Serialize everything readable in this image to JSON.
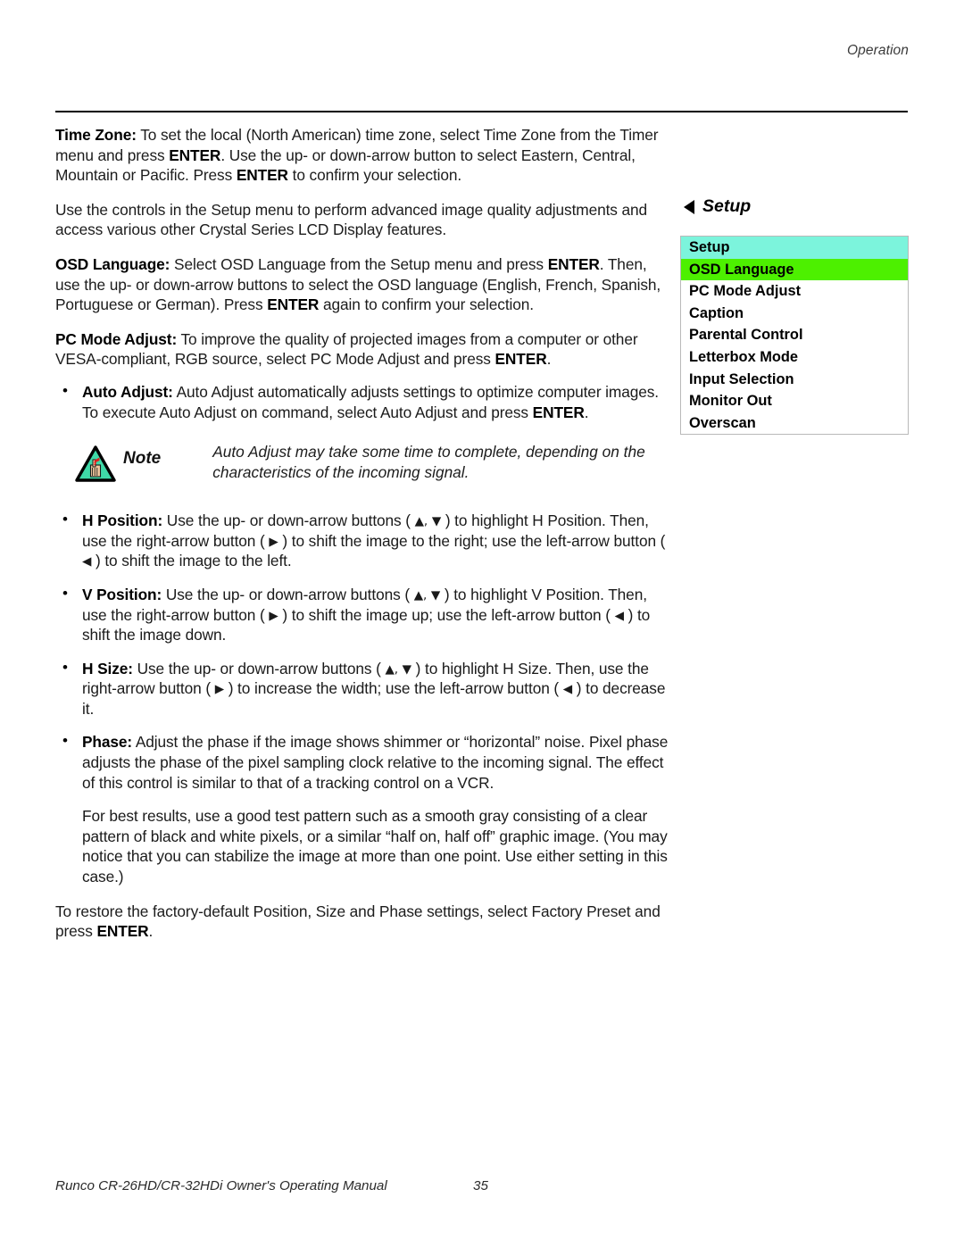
{
  "header": {
    "running_head": "Operation"
  },
  "footer": {
    "manual_title": "Runco CR-26HD/CR-32HDi Owner's Operating Manual",
    "page_number": "35"
  },
  "colors": {
    "osd_header_bg": "#7CF4DC",
    "osd_selected_bg": "#4DF000",
    "osd_border": "#b9b9b9",
    "note_triangle_fill": "#3FD9A8",
    "note_string_red": "#E01E1E"
  },
  "content": {
    "time_zone": {
      "term": "Time Zone:",
      "t1": " To set the local (North American) time zone, select Time Zone from the Timer menu and press ",
      "b1": "ENTER",
      "t2": ". Use the up- or down-arrow button to select Eastern, Central, Mountain or Pacific. Press ",
      "b2": "ENTER",
      "t3": " to confirm your selection."
    },
    "setup_intro": "Use the controls in the Setup menu to perform advanced image quality adjustments and access various other Crystal Series LCD Display features.",
    "osd_language": {
      "term": "OSD Language:",
      "t1": " Select OSD Language from the Setup menu and press ",
      "b1": "ENTER",
      "t2": ". Then, use the up- or down-arrow buttons to select the OSD language (English, French, Spanish, Portuguese or German). Press ",
      "b2": "ENTER",
      "t3": " again to confirm your selection."
    },
    "pc_mode_adjust": {
      "term": "PC Mode Adjust:",
      "t1": " To improve the quality of projected images from a computer or other VESA-compliant, RGB source, select PC Mode Adjust and press ",
      "b1": "ENTER",
      "t2": "."
    },
    "auto_adjust": {
      "term": "Auto Adjust:",
      "t1": " Auto Adjust automatically adjusts settings to optimize computer images. To execute Auto Adjust on command, select Auto Adjust and press ",
      "b1": "ENTER",
      "t2": "."
    },
    "note": {
      "label": "Note",
      "text": "Auto Adjust may take some time to complete, depending on the characteristics of the incoming signal."
    },
    "h_position": {
      "term": "H Position:",
      "t1": " Use the up- or down-arrow buttons ( ",
      "g1": "▲,",
      "g2": "▼",
      "t2": " ) to highlight H Position. Then, use the right-arrow button ( ",
      "g3": "▶",
      "t3": " ) to shift the image to the right; use the left-arrow button ( ",
      "g4": "◀",
      "t4": " ) to shift the image to the left."
    },
    "v_position": {
      "term": "V Position:",
      "t1": " Use the up- or down-arrow buttons ( ",
      "g1": "▲,",
      "g2": "▼",
      "t2": " ) to highlight V Position. Then, use the right-arrow button ( ",
      "g3": "▶",
      "t3": " ) to shift the image up; use the left-arrow button ( ",
      "g4": "◀",
      "t4": " ) to shift the image down."
    },
    "h_size": {
      "term": "H Size:",
      "t1": " Use the up- or down-arrow buttons ( ",
      "g1": "▲,",
      "g2": "▼",
      "t2": " ) to highlight H Size. Then, use the right-arrow button ( ",
      "g3": "▶",
      "t3": " ) to increase the width; use the left-arrow button ( ",
      "g4": "◀",
      "t4": " ) to decrease it."
    },
    "phase": {
      "term": "Phase:",
      "t1": " Adjust the phase if the image shows shimmer or “horizontal” noise. Pixel phase adjusts the phase of the pixel sampling clock relative to the incoming signal. The effect of this control is similar to that of a tracking control on a VCR."
    },
    "best_results": "For best results, use a good test pattern such as a smooth gray consisting of a clear pattern of black and white pixels, or a similar “half on, half off” graphic image. (You may notice that you can stabilize the image at more than one point. Use either setting in this case.)",
    "factory_preset": {
      "t1": "To restore the factory-default Position, Size and Phase settings, select Factory Preset and press ",
      "b1": "ENTER",
      "t2": "."
    }
  },
  "osd": {
    "heading": "Setup",
    "menu": [
      {
        "label": "Setup",
        "state": "header"
      },
      {
        "label": "OSD Language",
        "state": "selected"
      },
      {
        "label": "PC Mode Adjust",
        "state": "normal"
      },
      {
        "label": "Caption",
        "state": "normal"
      },
      {
        "label": "Parental Control",
        "state": "normal"
      },
      {
        "label": "Letterbox Mode",
        "state": "normal"
      },
      {
        "label": "Input Selection",
        "state": "normal"
      },
      {
        "label": "Monitor Out",
        "state": "normal"
      },
      {
        "label": "Overscan",
        "state": "normal"
      }
    ]
  }
}
